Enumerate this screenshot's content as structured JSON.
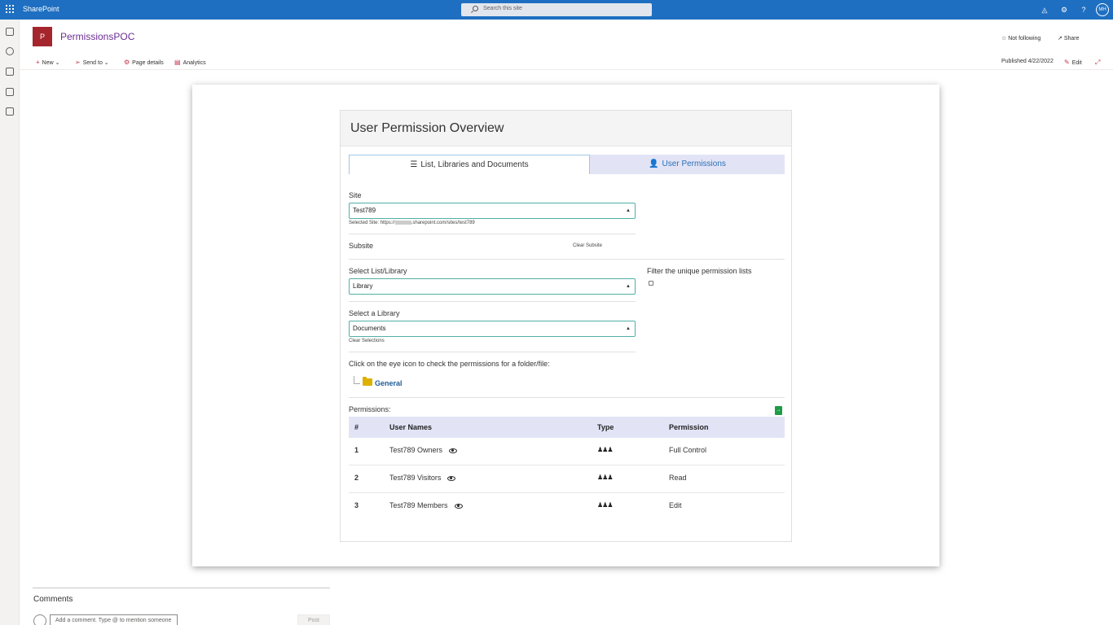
{
  "suitebar": {
    "app_name": "SharePoint",
    "search_placeholder": "Search this site",
    "avatar_initials": "MH",
    "icons": [
      "megaphone-icon",
      "gear-icon",
      "help-icon"
    ]
  },
  "rail": {
    "icons": [
      "home-icon",
      "globe-icon",
      "news-icon",
      "file-icon",
      "list-icon"
    ]
  },
  "site": {
    "logo_letter": "P",
    "title": "PermissionsPOC",
    "follow_label": "Not following",
    "share_label": "Share"
  },
  "command_bar": {
    "new_label": "New",
    "send_to_label": "Send to",
    "page_details_label": "Page details",
    "analytics_label": "Analytics",
    "published_label": "Published 4/22/2022",
    "edit_label": "Edit"
  },
  "webpart": {
    "title": "User Permission Overview",
    "tabs": [
      {
        "label": "List, Libraries and Documents",
        "icon": "list-icon"
      },
      {
        "label": "User Permissions",
        "icon": "user-icon"
      }
    ],
    "site_label": "Site",
    "site_value": "Test789",
    "selected_site_text": "Selected Site: https://",
    "selected_site_suffix": ".sharepoint.com/sites/test789",
    "subsite_label": "Subsite",
    "clear_subsite_label": "Clear Subsite",
    "list_library_label": "Select List/Library",
    "list_library_value": "Library",
    "filter_label": "Filter the unique permission lists",
    "library_label": "Select a Library",
    "library_value": "Documents",
    "clear_selections_label": "Clear Selections",
    "eye_instruction": "Click on the eye icon to check the permissions for a folder/file:",
    "folder_name": "General",
    "permissions_label": "Permissions:",
    "table": {
      "headers": [
        "#",
        "User Names",
        "Type",
        "Permission"
      ],
      "rows": [
        {
          "num": "1",
          "name": "Test789 Owners",
          "type_icon": "group-icon",
          "permission": "Full Control"
        },
        {
          "num": "2",
          "name": "Test789 Visitors",
          "type_icon": "group-icon",
          "permission": "Read"
        },
        {
          "num": "3",
          "name": "Test789 Members",
          "type_icon": "group-icon",
          "permission": "Edit"
        }
      ]
    }
  },
  "comments": {
    "title": "Comments",
    "input_placeholder": "Add a comment. Type @ to mention someone",
    "post_label": "Post"
  }
}
